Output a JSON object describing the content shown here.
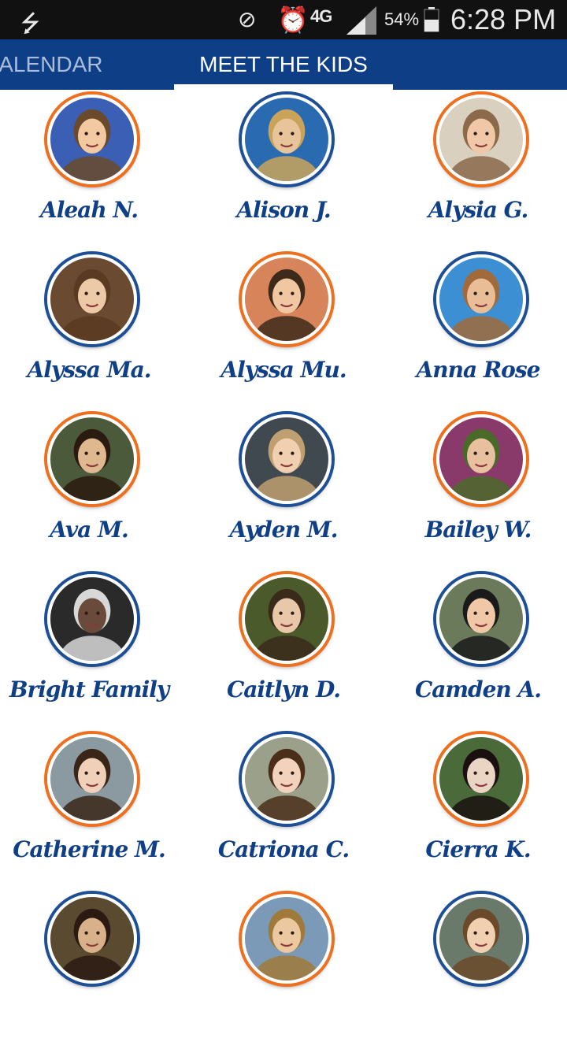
{
  "status_bar": {
    "usb_icon": "usb-icon",
    "mute_icon": "vibrate-off-icon",
    "alarm_icon": "alarm-icon",
    "network": "4G",
    "battery_percent": "54%",
    "time": "6:28 PM",
    "battery_level": 0.54
  },
  "tabs": [
    {
      "label": "CALENDAR",
      "selected": false
    },
    {
      "label": "MEET THE KIDS",
      "selected": true
    }
  ],
  "colors": {
    "tab_bar": "#0e3f86",
    "name_text": "#0f3f86",
    "ring_blue": "#1d4f96",
    "ring_orange": "#ee6f1e"
  },
  "kids": [
    {
      "name": "Aleah N.",
      "ring": "orange"
    },
    {
      "name": "Alison J.",
      "ring": "blue"
    },
    {
      "name": "Alysia G.",
      "ring": "orange"
    },
    {
      "name": "Alyssa Ma.",
      "ring": "blue"
    },
    {
      "name": "Alyssa Mu.",
      "ring": "orange"
    },
    {
      "name": "Anna Rose",
      "ring": "blue"
    },
    {
      "name": "Ava M.",
      "ring": "orange"
    },
    {
      "name": "Ayden M.",
      "ring": "blue"
    },
    {
      "name": "Bailey W.",
      "ring": "orange"
    },
    {
      "name": "Bright Family",
      "ring": "blue"
    },
    {
      "name": "Caitlyn D.",
      "ring": "orange"
    },
    {
      "name": "Camden A.",
      "ring": "blue"
    },
    {
      "name": "Catherine M.",
      "ring": "orange"
    },
    {
      "name": "Catriona C.",
      "ring": "blue"
    },
    {
      "name": "Cierra K.",
      "ring": "orange"
    },
    {
      "name": "",
      "ring": "blue"
    },
    {
      "name": "",
      "ring": "orange"
    },
    {
      "name": "",
      "ring": "blue"
    }
  ]
}
